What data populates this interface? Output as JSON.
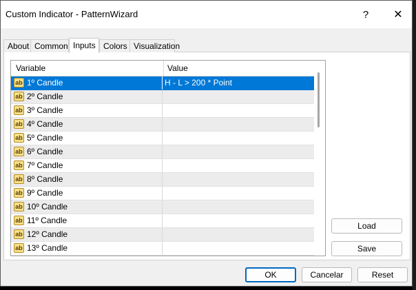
{
  "window": {
    "title": "Custom Indicator - PatternWizard",
    "help_label": "?",
    "close_label": "✕"
  },
  "tabs": [
    {
      "label": "About"
    },
    {
      "label": "Common"
    },
    {
      "label": "Inputs"
    },
    {
      "label": "Colors"
    },
    {
      "label": "Visualization"
    }
  ],
  "active_tab": "Inputs",
  "grid": {
    "columns": [
      "Variable",
      "Value"
    ],
    "type_icon": "ab",
    "rows": [
      {
        "variable": "1º Candle",
        "value": "H - L > 200 * Point"
      },
      {
        "variable": "2º Candle",
        "value": ""
      },
      {
        "variable": "3º Candle",
        "value": ""
      },
      {
        "variable": "4º Candle",
        "value": ""
      },
      {
        "variable": "5º Candle",
        "value": ""
      },
      {
        "variable": "6º Candle",
        "value": ""
      },
      {
        "variable": "7º Candle",
        "value": ""
      },
      {
        "variable": "8º Candle",
        "value": ""
      },
      {
        "variable": "9º Candle",
        "value": ""
      },
      {
        "variable": "10º Candle",
        "value": ""
      },
      {
        "variable": "11º Candle",
        "value": ""
      },
      {
        "variable": "12º Candle",
        "value": ""
      },
      {
        "variable": "13º Candle",
        "value": ""
      }
    ]
  },
  "buttons": {
    "load": "Load",
    "save": "Save",
    "ok": "OK",
    "cancel": "Cancelar",
    "reset": "Reset"
  },
  "colors": {
    "selection": "#0078d7",
    "ok_border": "#0067c0",
    "alt_row": "#ececec",
    "icon_fill": "#f7e08a"
  },
  "icons": {
    "row_type": "string-type-icon",
    "close": "close-icon",
    "help": "help-icon"
  }
}
